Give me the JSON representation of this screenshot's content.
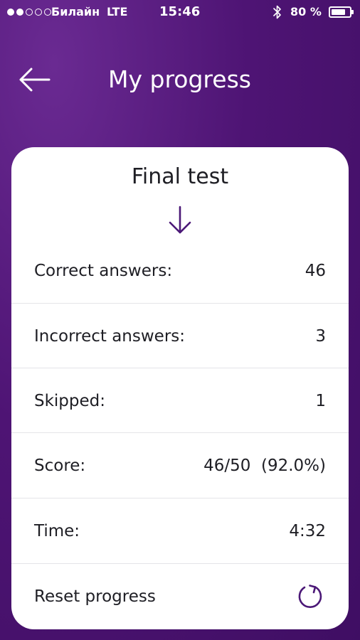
{
  "status_bar": {
    "signal_filled": 2,
    "signal_total": 5,
    "carrier": "Билайн",
    "network": "LTE",
    "time": "15:46",
    "battery_percent": "80 %",
    "battery_level": 0.8
  },
  "header": {
    "title": "My progress",
    "back_icon": "back-arrow-icon"
  },
  "card": {
    "title": "Final test",
    "arrow_icon": "arrow-down-icon",
    "rows": [
      {
        "label": "Correct answers:",
        "value": "46"
      },
      {
        "label": "Incorrect answers:",
        "value": "3"
      },
      {
        "label": "Skipped:",
        "value": "1"
      },
      {
        "label": "Score:",
        "value": "46/50  (92.0%)"
      },
      {
        "label": "Time:",
        "value": "4:32"
      }
    ],
    "reset": {
      "label": "Reset progress",
      "icon": "refresh-icon"
    }
  },
  "colors": {
    "background": "#4e1474",
    "accent": "#4b1877",
    "card": "#ffffff",
    "text_dark": "#1e1e24"
  }
}
